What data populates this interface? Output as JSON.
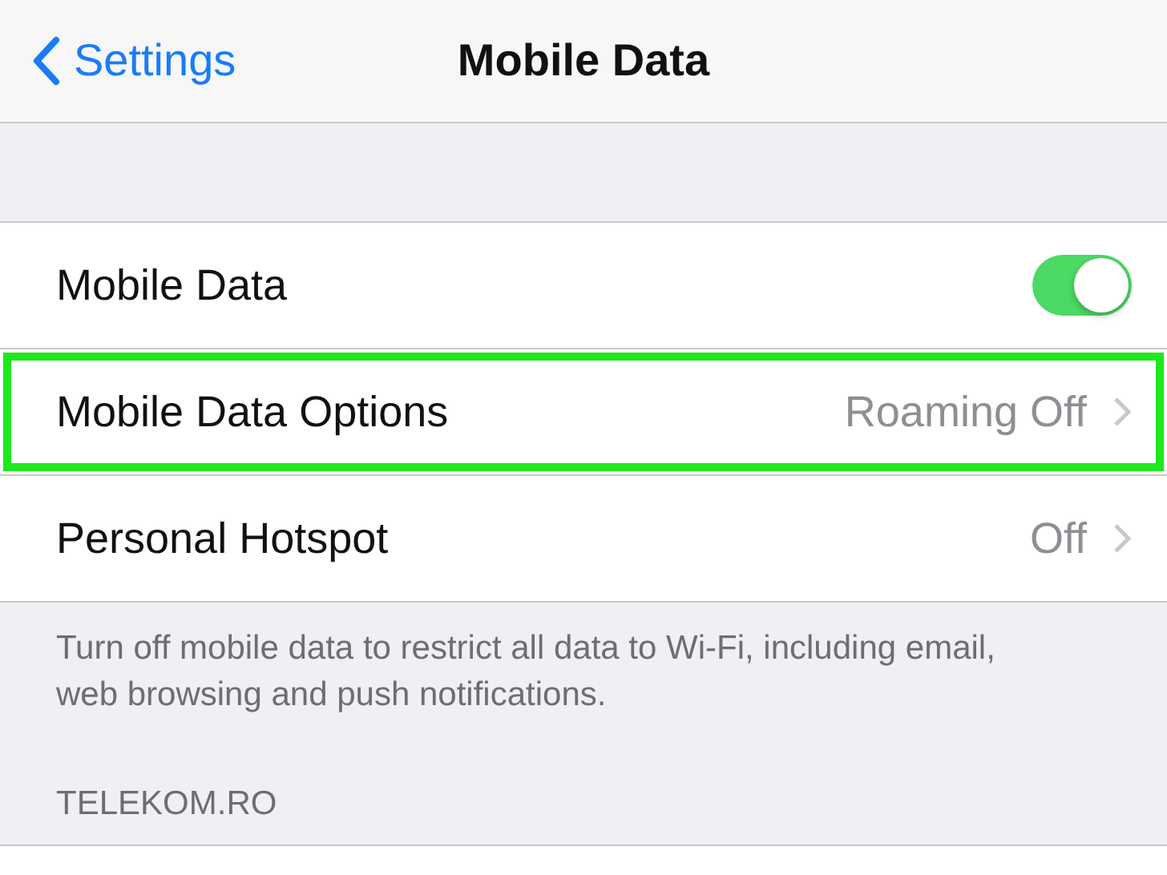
{
  "nav": {
    "back_label": "Settings",
    "title": "Mobile Data"
  },
  "rows": [
    {
      "kind": "toggle",
      "label": "Mobile Data",
      "on": true,
      "highlighted": false
    },
    {
      "kind": "link",
      "label": "Mobile Data Options",
      "value": "Roaming Off",
      "highlighted": true
    },
    {
      "kind": "link",
      "label": "Personal Hotspot",
      "value": "Off",
      "highlighted": false
    }
  ],
  "footer": "Turn off mobile data to restrict all data to Wi-Fi, including email, web browsing and push notifications.",
  "section_header": "TELEKOM.RO"
}
